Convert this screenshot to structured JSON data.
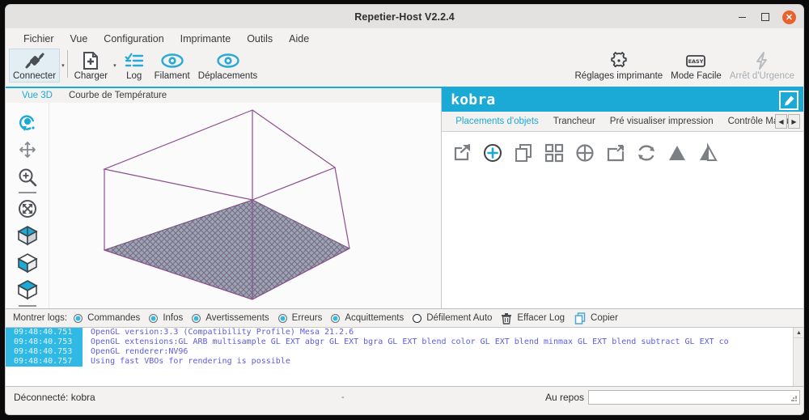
{
  "window": {
    "title": "Repetier-Host V2.2.4",
    "minimize_label": "Minimiser",
    "maximize_label": "Agrandir",
    "close_label": "Fermer"
  },
  "menubar": {
    "items": [
      {
        "label": "Fichier"
      },
      {
        "label": "Vue"
      },
      {
        "label": "Configuration"
      },
      {
        "label": "Imprimante"
      },
      {
        "label": "Outils"
      },
      {
        "label": "Aide"
      }
    ]
  },
  "toolbar": {
    "left_items": [
      {
        "label": "Connecter",
        "icon": "plug-icon",
        "selected": true,
        "has_caret": true
      },
      {
        "label": "Charger",
        "icon": "file-add-icon",
        "selected": false,
        "has_caret": true
      },
      {
        "label": "Log",
        "icon": "list-check-icon",
        "selected": false,
        "has_caret": false
      },
      {
        "label": "Filament",
        "icon": "eye-icon",
        "selected": false,
        "has_caret": false
      },
      {
        "label": "Déplacements",
        "icon": "eye-icon",
        "selected": false,
        "has_caret": false
      }
    ],
    "right_items": [
      {
        "label": "Réglages imprimante",
        "icon": "gear-icon",
        "disabled": false
      },
      {
        "label": "Mode Facile",
        "icon": "easy-badge-icon",
        "disabled": false
      },
      {
        "label": "Arrêt d'Urgence",
        "icon": "bolt-icon",
        "disabled": true
      }
    ]
  },
  "view3d": {
    "tabs": [
      {
        "label": "Vue 3D",
        "active": true
      },
      {
        "label": "Courbe de Température",
        "active": false
      }
    ],
    "tools": [
      {
        "name": "rotate-view-icon"
      },
      {
        "name": "move-view-icon"
      },
      {
        "name": "zoom-view-icon"
      },
      {
        "name": "fit-view-icon"
      },
      {
        "name": "cube-top-view-icon"
      },
      {
        "name": "cube-front-view-icon"
      },
      {
        "name": "cube-side-view-icon"
      }
    ]
  },
  "right_panel": {
    "printer_name": "kobra",
    "edit_icon": "edit-pencil-icon",
    "tabs": [
      {
        "label": "Placements d'objets",
        "active": true
      },
      {
        "label": "Trancheur",
        "active": false
      },
      {
        "label": "Pré visualiser impression",
        "active": false
      },
      {
        "label": "Contrôle Manuel",
        "active": false
      }
    ],
    "tab_scroll_left": "◀",
    "tab_scroll_right": "▶",
    "object_tools": [
      {
        "name": "export-object-icon"
      },
      {
        "name": "add-object-icon"
      },
      {
        "name": "copy-object-icon"
      },
      {
        "name": "autoposition-object-icon"
      },
      {
        "name": "center-object-icon"
      },
      {
        "name": "scale-object-icon"
      },
      {
        "name": "rotate-object-icon"
      },
      {
        "name": "mirror-object-icon"
      },
      {
        "name": "flip-object-icon"
      }
    ]
  },
  "log_panel": {
    "show_logs_label": "Montrer logs:",
    "filters": [
      {
        "label": "Commandes",
        "checked": true
      },
      {
        "label": "Infos",
        "checked": true
      },
      {
        "label": "Avertissements",
        "checked": true
      },
      {
        "label": "Erreurs",
        "checked": true
      },
      {
        "label": "Acquittements",
        "checked": true
      },
      {
        "label": "Défilement Auto",
        "checked": false
      }
    ],
    "actions": [
      {
        "label": "Effacer Log",
        "icon": "trash-icon"
      },
      {
        "label": "Copier",
        "icon": "copy-icon"
      }
    ],
    "entries": [
      {
        "time": "09:48:40.751",
        "message": "OpenGL version:3.3 (Compatibility Profile) Mesa 21.2.6"
      },
      {
        "time": "09:48:40.753",
        "message": "OpenGL extensions:GL ARB multisample GL EXT abgr GL EXT bgra GL EXT blend color GL EXT blend minmax GL EXT blend subtract GL EXT co"
      },
      {
        "time": "09:48:40.753",
        "message": "OpenGL renderer:NV96"
      },
      {
        "time": "09:48:40.757",
        "message": "Using fast VBOs for rendering is possible"
      }
    ]
  },
  "statusbar": {
    "connection": "Déconnecté: kobra",
    "separator": "-",
    "state": "Au repos",
    "progress_value": ""
  },
  "colors": {
    "accent": "#1ba9d6",
    "log_time_bg": "#2fb9e4",
    "log_text": "#5c5ce0",
    "close_button": "#e8622a"
  }
}
